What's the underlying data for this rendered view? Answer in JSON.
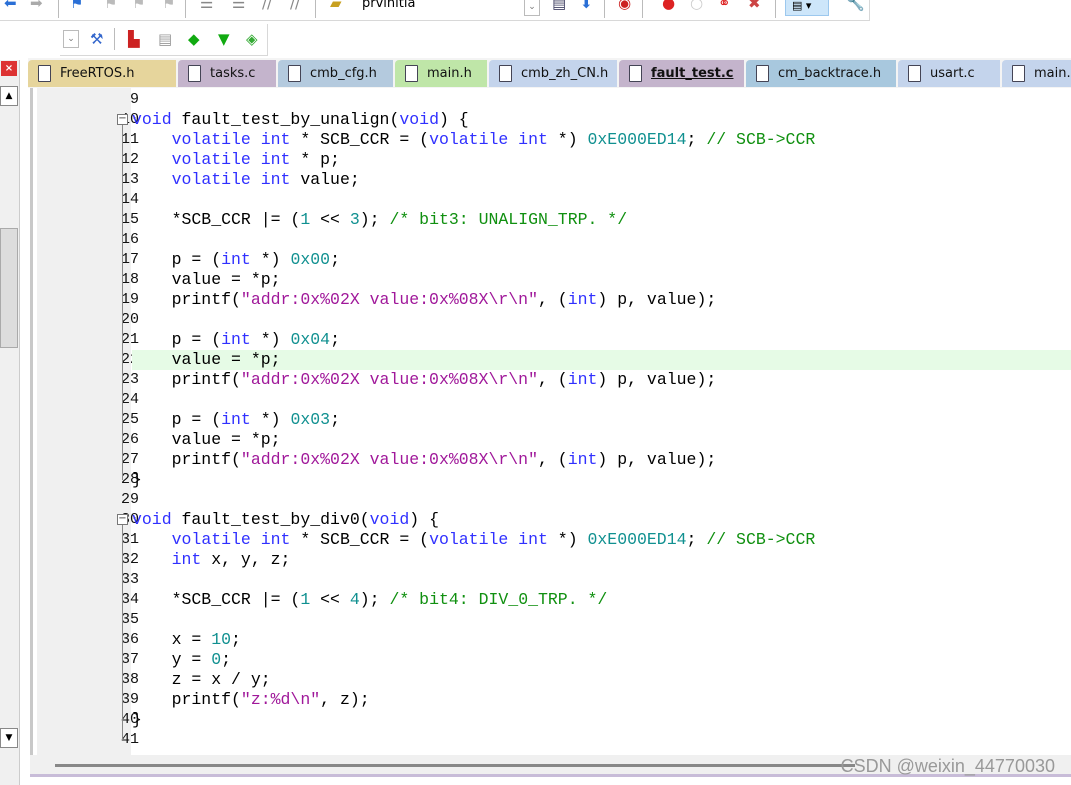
{
  "toolbar": {
    "project_combo": "prvinitia"
  },
  "tabs": [
    {
      "label": "FreeRTOS.h",
      "color": "#e6d59c"
    },
    {
      "label": "tasks.c",
      "color": "#c4b4cc"
    },
    {
      "label": "cmb_cfg.h",
      "color": "#b4cade"
    },
    {
      "label": "main.h",
      "color": "#bfe6a8"
    },
    {
      "label": "cmb_zh_CN.h",
      "color": "#c4d4ec"
    },
    {
      "label": "fault_test.c",
      "color": "#c4b4cc",
      "active": true
    },
    {
      "label": "cm_backtrace.h",
      "color": "#a8c8de"
    },
    {
      "label": "usart.c",
      "color": "#c4d4ec"
    },
    {
      "label": "main.",
      "color": "#c4d4ec"
    }
  ],
  "editor": {
    "highlighted_line": 22,
    "lines": [
      {
        "n": "9",
        "t": []
      },
      {
        "n": "10",
        "fold": true,
        "t": [
          [
            "kw",
            "void"
          ],
          [
            "",
            "fault_test_by_unalign("
          ],
          [
            "kw",
            "void"
          ],
          [
            "",
            ") {"
          ]
        ]
      },
      {
        "n": "11",
        "t": [
          [
            "",
            "    "
          ],
          [
            "kw",
            "volatile int"
          ],
          [
            "",
            "",
            " * SCB_CCR = ("
          ],
          [
            "kw",
            "volatile int"
          ],
          [
            "",
            " *) "
          ],
          [
            "num",
            "0xE000ED14"
          ],
          [
            "",
            "; "
          ],
          [
            "cmt",
            "// SCB->CCR"
          ]
        ]
      },
      {
        "n": "12",
        "t": [
          [
            "",
            "    "
          ],
          [
            "kw",
            "volatile int"
          ],
          [
            "",
            " * p;"
          ]
        ]
      },
      {
        "n": "13",
        "t": [
          [
            "",
            "    "
          ],
          [
            "kw",
            "volatile int"
          ],
          [
            "",
            " value;"
          ]
        ]
      },
      {
        "n": "14",
        "t": []
      },
      {
        "n": "15",
        "t": [
          [
            "",
            "    *SCB_CCR |= ("
          ],
          [
            "num",
            "1"
          ],
          [
            "",
            " << "
          ],
          [
            "num",
            "3"
          ],
          [
            "",
            "); "
          ],
          [
            "cmt",
            "/* bit3: UNALIGN_TRP. */"
          ]
        ]
      },
      {
        "n": "16",
        "t": []
      },
      {
        "n": "17",
        "t": [
          [
            "",
            "    p = ("
          ],
          [
            "kw",
            "int"
          ],
          [
            "",
            " *) "
          ],
          [
            "num",
            "0x00"
          ],
          [
            "",
            ";"
          ]
        ]
      },
      {
        "n": "18",
        "t": [
          [
            "",
            "    value = *p;"
          ]
        ]
      },
      {
        "n": "19",
        "t": [
          [
            "",
            "    printf("
          ],
          [
            "str",
            "\"addr:0x%02X value:0x%08X\\r\\n\""
          ],
          [
            "",
            ", ("
          ],
          [
            "kw",
            "int"
          ],
          [
            "",
            ") p, value);"
          ]
        ]
      },
      {
        "n": "20",
        "t": []
      },
      {
        "n": "21",
        "t": [
          [
            "",
            "    p = ("
          ],
          [
            "kw",
            "int"
          ],
          [
            "",
            " *) "
          ],
          [
            "num",
            "0x04"
          ],
          [
            "",
            ";"
          ]
        ]
      },
      {
        "n": "22",
        "t": [
          [
            "",
            "    value = *p;"
          ]
        ]
      },
      {
        "n": "23",
        "t": [
          [
            "",
            "    printf("
          ],
          [
            "str",
            "\"addr:0x%02X value:0x%08X\\r\\n\""
          ],
          [
            "",
            ", ("
          ],
          [
            "kw",
            "int"
          ],
          [
            "",
            ") p, value);"
          ]
        ]
      },
      {
        "n": "24",
        "t": []
      },
      {
        "n": "25",
        "t": [
          [
            "",
            "    p = ("
          ],
          [
            "kw",
            "int"
          ],
          [
            "",
            " *) "
          ],
          [
            "num",
            "0x03"
          ],
          [
            "",
            ";"
          ]
        ]
      },
      {
        "n": "26",
        "t": [
          [
            "",
            "    value = *p;"
          ]
        ]
      },
      {
        "n": "27",
        "t": [
          [
            "",
            "    printf("
          ],
          [
            "str",
            "\"addr:0x%02X value:0x%08X\\r\\n\""
          ],
          [
            "",
            ", ("
          ],
          [
            "kw",
            "int"
          ],
          [
            "",
            ") p, value);"
          ]
        ]
      },
      {
        "n": "28",
        "t": [
          [
            "",
            "}"
          ]
        ]
      },
      {
        "n": "29",
        "t": []
      },
      {
        "n": "30",
        "fold": true,
        "t": [
          [
            "kw",
            "void"
          ],
          [
            "",
            "fault_test_by_div0("
          ],
          [
            "kw",
            "void"
          ],
          [
            "",
            ") {"
          ]
        ]
      },
      {
        "n": "31",
        "t": [
          [
            "",
            "    "
          ],
          [
            "kw",
            "volatile int"
          ],
          [
            "",
            " * SCB_CCR = ("
          ],
          [
            "kw",
            "volatile int"
          ],
          [
            "",
            " *) "
          ],
          [
            "num",
            "0xE000ED14"
          ],
          [
            "",
            "; "
          ],
          [
            "cmt",
            "// SCB->CCR"
          ]
        ]
      },
      {
        "n": "32",
        "t": [
          [
            "",
            "    "
          ],
          [
            "kw",
            "int"
          ],
          [
            "",
            " x, y, z;"
          ]
        ]
      },
      {
        "n": "33",
        "t": []
      },
      {
        "n": "34",
        "t": [
          [
            "",
            "    *SCB_CCR |= ("
          ],
          [
            "num",
            "1"
          ],
          [
            "",
            " << "
          ],
          [
            "num",
            "4"
          ],
          [
            "",
            "); "
          ],
          [
            "cmt",
            "/* bit4: DIV_0_TRP. */"
          ]
        ]
      },
      {
        "n": "35",
        "t": []
      },
      {
        "n": "36",
        "t": [
          [
            "",
            "    x = "
          ],
          [
            "num",
            "10"
          ],
          [
            "",
            ";"
          ]
        ]
      },
      {
        "n": "37",
        "t": [
          [
            "",
            "    y = "
          ],
          [
            "num",
            "0"
          ],
          [
            "",
            ";"
          ]
        ]
      },
      {
        "n": "38",
        "t": [
          [
            "",
            "    z = x / y;"
          ]
        ]
      },
      {
        "n": "39",
        "t": [
          [
            "",
            "    printf("
          ],
          [
            "str",
            "\"z:%d\\n\""
          ],
          [
            "",
            ", z);"
          ]
        ]
      },
      {
        "n": "40",
        "t": [
          [
            "",
            "}"
          ]
        ]
      },
      {
        "n": "41",
        "t": []
      }
    ]
  },
  "watermark": "CSDN @weixin_44770030"
}
